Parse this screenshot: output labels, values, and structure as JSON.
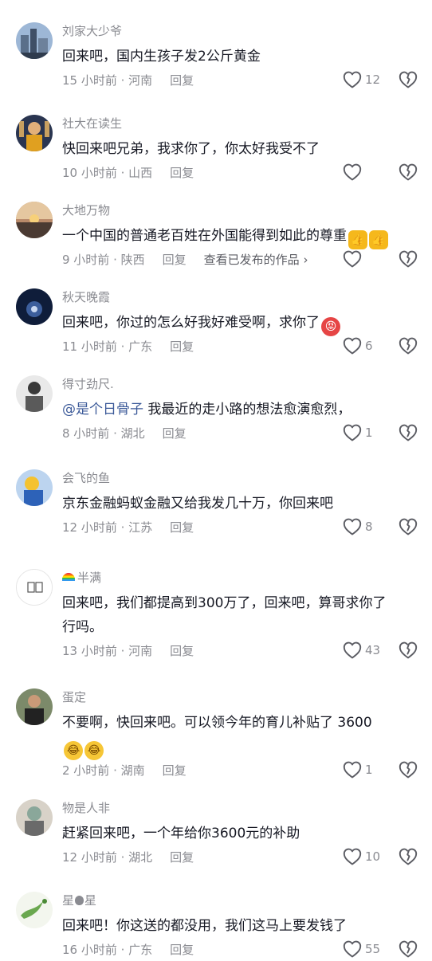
{
  "colors": {
    "text": "#161823",
    "muted": "#8a8b91",
    "mention": "#3c5a99",
    "icon": "#5b5c63"
  },
  "comments": [
    {
      "user": "刘家大少爷",
      "text": "回来吧，国内生孩子发2公斤黄金",
      "time": "15 小时前 · 河南",
      "reply": "回复",
      "likes": "12"
    },
    {
      "user": "社大在读生",
      "text": "快回来吧兄弟，我求你了，你太好我受不了",
      "time": "10 小时前 · 山西",
      "reply": "回复",
      "likes": ""
    },
    {
      "user": "大地万物",
      "text": "一个中国的普通老百姓在外国能得到如此的尊重",
      "time": "9 小时前 · 陕西",
      "reply": "回复",
      "works": "查看已发布的作品",
      "likes": ""
    },
    {
      "user": "秋天晚霞",
      "text": "回来吧，你过的怎么好我好难受啊，求你了",
      "time": "11 小时前 · 广东",
      "reply": "回复",
      "likes": "6"
    },
    {
      "user": "得寸劲尺.",
      "mention": "@是个日骨子",
      "text": " 我最近的走小路的想法愈演愈烈，",
      "time": "8 小时前 · 湖北",
      "reply": "回复",
      "likes": "1"
    },
    {
      "user": "会飞的鱼",
      "text": "京东金融蚂蚁金融又给我发几十万，你回来吧",
      "time": "12 小时前 · 江苏",
      "reply": "回复",
      "likes": "8"
    },
    {
      "user": "半满",
      "text_line1": "回来吧，我们都提高到300万了，回来吧，算哥求你了",
      "text_line2": "行吗。",
      "time": "13 小时前 · 河南",
      "reply": "回复",
      "likes": "43"
    },
    {
      "user": "蛋定",
      "text": "不要啊，快回来吧。可以领今年的育儿补贴了 3600",
      "time": "2 小时前 · 湖南",
      "reply": "回复",
      "likes": "1"
    },
    {
      "user": "物是人非",
      "text": "赶紧回来吧，一个年给你3600元的补助",
      "time": "12 小时前 · 湖北",
      "reply": "回复",
      "likes": "10"
    },
    {
      "user_a": "星",
      "user_b": "星",
      "text": "回来吧！你这送的都没用，我们这马上要发钱了",
      "time": "16 小时前 · 广东",
      "reply": "回复",
      "likes": "55"
    }
  ],
  "icons": {
    "like": "heart-outline-icon",
    "dislike": "broken-heart-icon",
    "chevron": "chevron-right-icon",
    "rainbow": "rainbow-emoji",
    "apple": "apple-logo"
  }
}
